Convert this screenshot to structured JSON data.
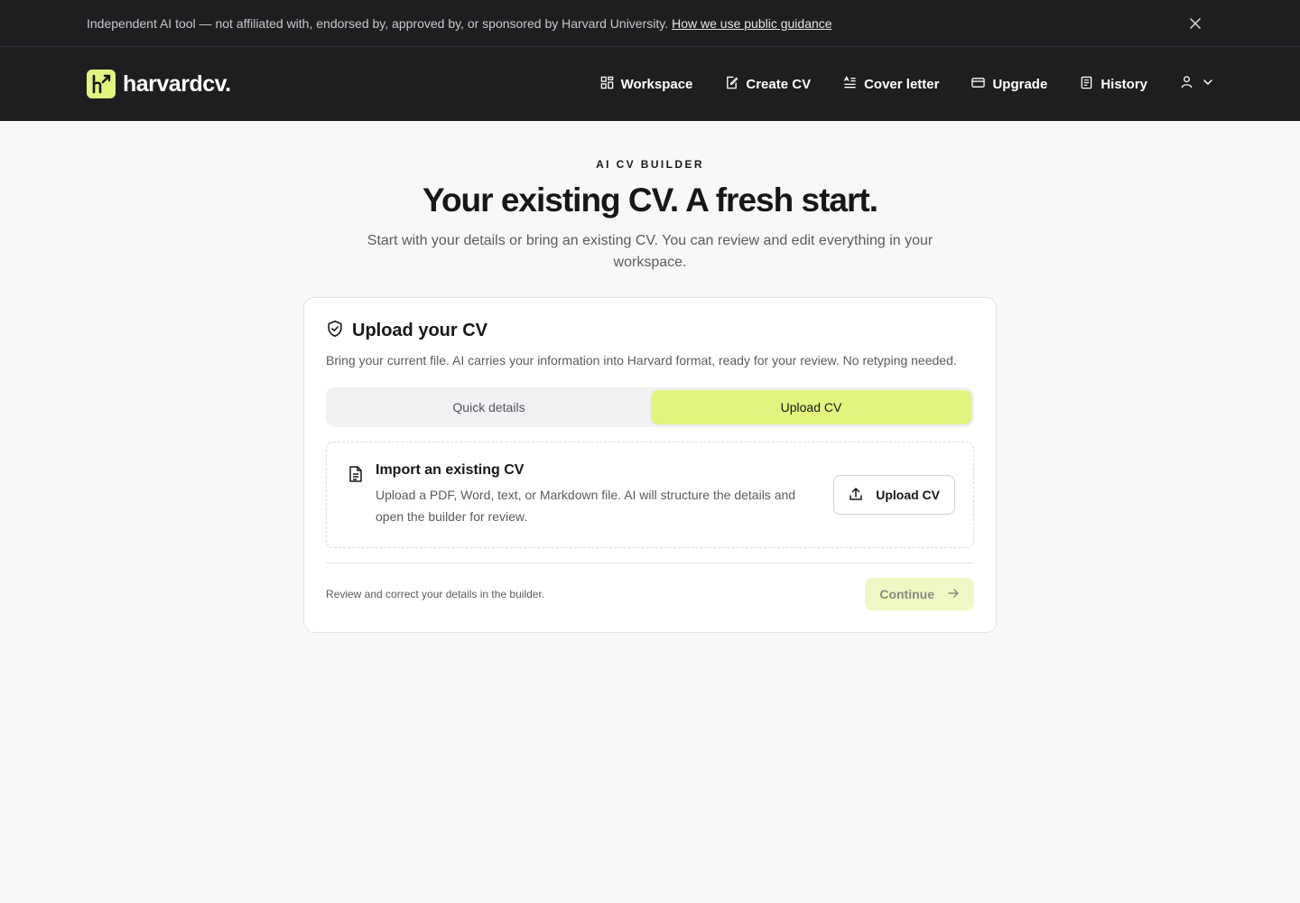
{
  "banner": {
    "text": "Independent AI tool — not affiliated with, endorsed by, approved by, or sponsored by Harvard University.",
    "link_text": "How we use public guidance",
    "close_icon": "close-icon"
  },
  "header": {
    "brand_name": "harvardcv.",
    "nav": [
      {
        "label": "Workspace",
        "icon": "grid-icon"
      },
      {
        "label": "Create CV",
        "icon": "edit-document-icon"
      },
      {
        "label": "Cover letter",
        "icon": "text-lines-icon"
      },
      {
        "label": "Upgrade",
        "icon": "card-icon"
      },
      {
        "label": "History",
        "icon": "list-document-icon"
      }
    ],
    "account_icon": "user-icon"
  },
  "hero": {
    "eyebrow": "AI CV BUILDER",
    "title": "Your existing CV. A fresh start.",
    "subtitle": "Start with your details or bring an existing CV. You can review and edit everything in your workspace."
  },
  "card": {
    "title": "Upload your CV",
    "description": "Bring your current file. AI carries your information into Harvard format, ready for your review. No retyping needed.",
    "tabs": [
      {
        "label": "Quick details",
        "active": false
      },
      {
        "label": "Upload CV",
        "active": true
      }
    ],
    "import": {
      "title": "Import an existing CV",
      "description": "Upload a PDF, Word, text, or Markdown file. AI will structure the details and open the builder for review.",
      "button_label": "Upload CV"
    },
    "footer_note": "Review and correct your details in the builder.",
    "continue_label": "Continue"
  },
  "colors": {
    "accent": "#dff57e",
    "header_bg": "#1d1e20",
    "page_bg": "#f8f8f9"
  }
}
